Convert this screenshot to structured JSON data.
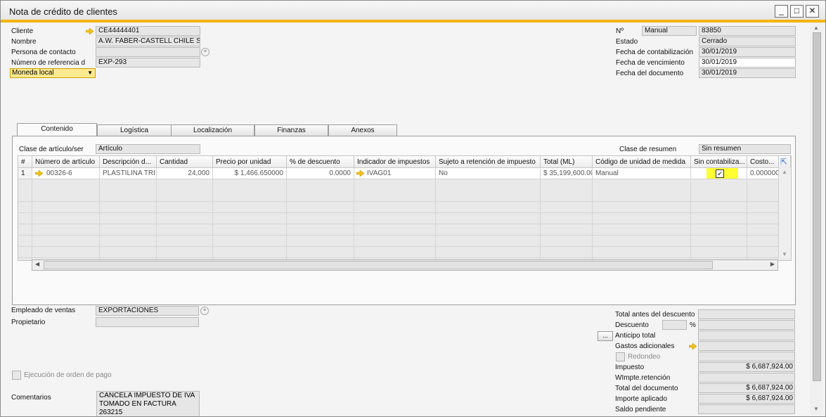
{
  "window": {
    "title": "Nota de crédito de clientes",
    "minimize": "_",
    "maximize": "□",
    "close": "✕"
  },
  "header_left": {
    "cliente_label": "Cliente",
    "cliente_value": "CE44444401",
    "nombre_label": "Nombre",
    "nombre_value": "A.W. FABER-CASTELL CHILE S.",
    "contacto_label": "Persona de contacto",
    "contacto_value": "",
    "referencia_label": "Número de referencia d",
    "referencia_value": "EXP-293",
    "moneda_value": "Moneda local"
  },
  "header_right": {
    "no_label": "Nº",
    "serie_value": "Manual",
    "numero_value": "83850",
    "estado_label": "Estado",
    "estado_value": "Cerrado",
    "contab_label": "Fecha de contabilización",
    "contab_value": "30/01/2019",
    "venc_label": "Fecha de vencimiento",
    "venc_value": "30/01/2019",
    "doc_label": "Fecha del documento",
    "doc_value": "30/01/2019"
  },
  "tabs": [
    "Contenido",
    "Logística",
    "Localización",
    "Finanzas",
    "Anexos"
  ],
  "content": {
    "clase_label": "Clase de artículo/ser",
    "clase_value": "Artículo",
    "resumen_label": "Clase de resumen",
    "resumen_value": "Sin resumen"
  },
  "grid": {
    "columns": [
      "#",
      "Número de artículo",
      "Descripción d...",
      "Cantidad",
      "Precio por unidad",
      "% de descuento",
      "Indicador de impuestos",
      "Sujeto a retención de impuesto",
      "Total (ML)",
      "Código de unidad de medida",
      "Sin contabiliza...",
      "Costo..."
    ],
    "row": {
      "num": "1",
      "articulo": "00326-6",
      "descripcion": "PLASTILINA TRI",
      "cantidad": "24,000",
      "precio": "$ 1,466.650000",
      "descuento": "0.0000",
      "impuesto": "IVAG01",
      "retencion": "No",
      "total": "$ 35,199,600.00",
      "unidad": "Manual",
      "sin_contab": "✔",
      "costo": "0.000000"
    }
  },
  "footer_left": {
    "empleado_label": "Empleado de ventas",
    "empleado_value": "EXPORTACIONES",
    "propietario_label": "Propietario",
    "propietario_value": "",
    "ejecucion_label": "Ejecución de orden de pago",
    "comentarios_label": "Comentarios",
    "comentarios_line1": "CANCELA IMPUESTO DE IVA",
    "comentarios_line2": "TOMADO EN FACTURA",
    "comentarios_line3": "263215"
  },
  "totals": {
    "antes_label": "Total antes del descuento",
    "antes_value": "",
    "descuento_label": "Descuento",
    "pct": "%",
    "anticipo_btn": "...",
    "anticipo_label": "Anticipo total",
    "gastos_label": "Gastos adicionales",
    "redondeo_label": "Redondeo",
    "impuesto_label": "Impuesto",
    "impuesto_value": "$ 6,687,924.00",
    "wimpte_label": "WImpte.retención",
    "total_doc_label": "Total del documento",
    "total_doc_value": "$ 6,687,924.00",
    "aplicado_label": "Importe aplicado",
    "aplicado_value": "$ 6,687,924.00",
    "saldo_label": "Saldo pendiente"
  },
  "colors": {
    "accent": "#f5b400",
    "highlight": "#ffff33",
    "arrow": "#f2c21a"
  }
}
